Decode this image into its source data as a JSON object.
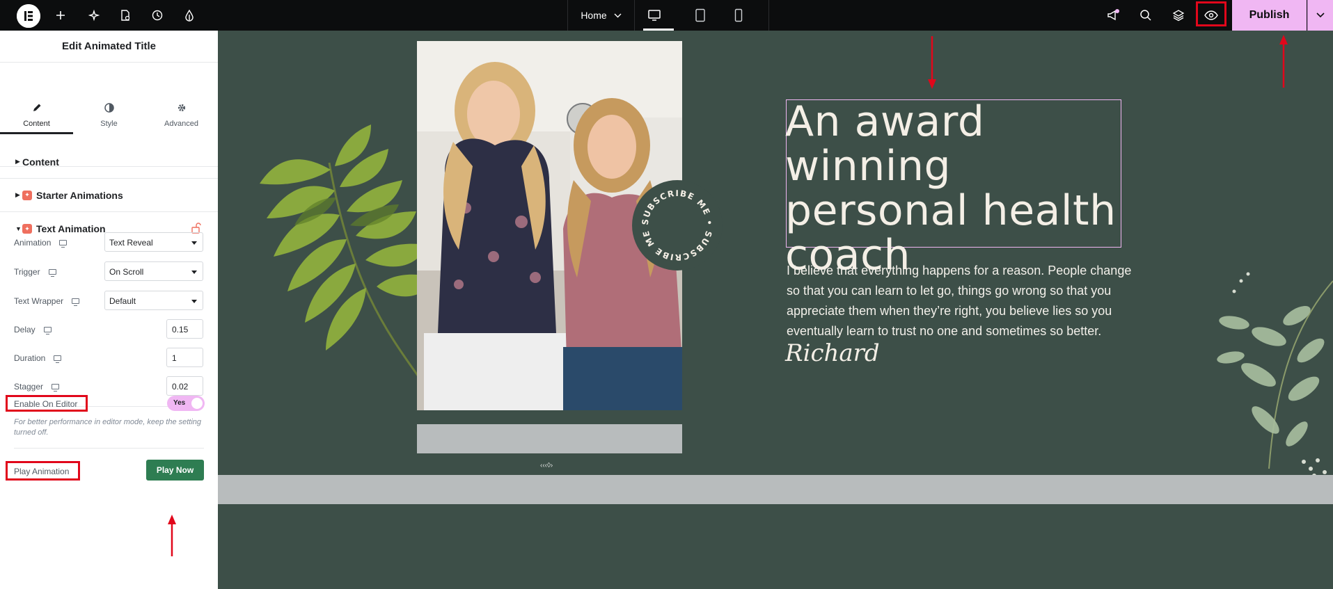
{
  "topbar": {
    "page_name": "Home",
    "publish_label": "Publish"
  },
  "sidebar": {
    "title": "Edit Animated Title",
    "tabs": [
      {
        "label": "Content",
        "icon": "pencil-icon"
      },
      {
        "label": "Style",
        "icon": "contrast-icon"
      },
      {
        "label": "Advanced",
        "icon": "gear-icon"
      }
    ],
    "sections": {
      "content": "Content",
      "starter": "Starter Animations",
      "text_animation": "Text Animation"
    },
    "fields": {
      "animation": {
        "label": "Animation",
        "value": "Text Reveal"
      },
      "trigger": {
        "label": "Trigger",
        "value": "On Scroll"
      },
      "wrapper": {
        "label": "Text Wrapper",
        "value": "Default"
      },
      "delay": {
        "label": "Delay",
        "value": "0.15"
      },
      "duration": {
        "label": "Duration",
        "value": "1"
      },
      "stagger": {
        "label": "Stagger",
        "value": "0.02"
      }
    },
    "enable_on_editor": {
      "label": "Enable On Editor",
      "toggle": "Yes",
      "hint": "For better performance in editor mode, keep the setting turned off."
    },
    "play_animation": {
      "label": "Play Animation",
      "button": "Play Now"
    }
  },
  "canvas": {
    "badge_text": "SUBSCRIBE ME • SUBSCRIBE ME •",
    "headline": "An award winning personal health coach",
    "bio": "I believe that everything happens for a reason. People change so that you can learn to let go, things go wrong so that you appreciate them when they’re right, you believe lies so you eventually learn to trust no one and sometimes so better.",
    "signature": "Richard"
  },
  "colors": {
    "topbar_bg": "#0c0d0e",
    "publish_bg": "#f0b7f3",
    "canvas_bg": "#3d4f48",
    "play_button": "#2e7d52",
    "annotation_red": "#e1071b"
  }
}
